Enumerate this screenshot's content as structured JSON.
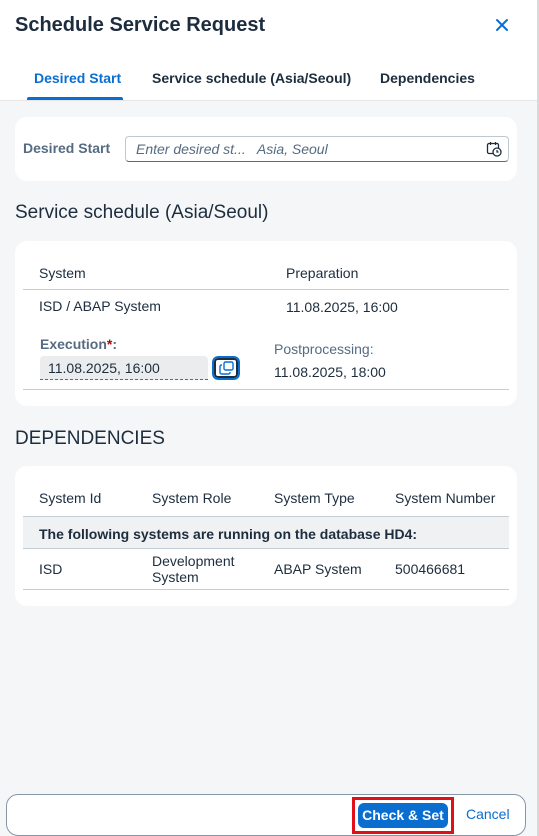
{
  "dialog": {
    "title": "Schedule Service Request",
    "close_icon": "close-icon"
  },
  "tabs": [
    {
      "label": "Desired Start",
      "active": true
    },
    {
      "label": "Service schedule (Asia/Seoul)",
      "active": false
    },
    {
      "label": "Dependencies",
      "active": false
    }
  ],
  "desired_start": {
    "label": "Desired Start",
    "placeholder": "Enter desired st...   Asia, Seoul",
    "value": "",
    "icon": "calendar-clock-icon"
  },
  "service_schedule": {
    "title": "Service schedule (Asia/Seoul)",
    "col_system": "System",
    "col_preparation": "Preparation",
    "system_value": "ISD / ABAP System",
    "preparation_value": "11.08.2025, 16:00",
    "execution_label": "Execution",
    "execution_required": "*",
    "execution_colon": ":",
    "execution_value": "11.08.2025, 16:00",
    "copy_icon": "copy-icon",
    "postprocessing_label": "Postprocessing:",
    "postprocessing_value": "11.08.2025, 18:00"
  },
  "dependencies": {
    "title": "DEPENDENCIES",
    "columns": [
      "System Id",
      "System Role",
      "System Type",
      "System Number"
    ],
    "group_text": "The following systems are running on the database HD4:",
    "rows": [
      {
        "system_id": "ISD",
        "system_role_1": "Development",
        "system_role_2": "System",
        "system_type": "ABAP System",
        "system_number": "500466681"
      }
    ]
  },
  "footer": {
    "primary_label": "Check & Set",
    "cancel_label": "Cancel"
  },
  "colors": {
    "accent": "#0a6ed1",
    "highlight_border": "#e0101b",
    "required": "#aa0808"
  }
}
